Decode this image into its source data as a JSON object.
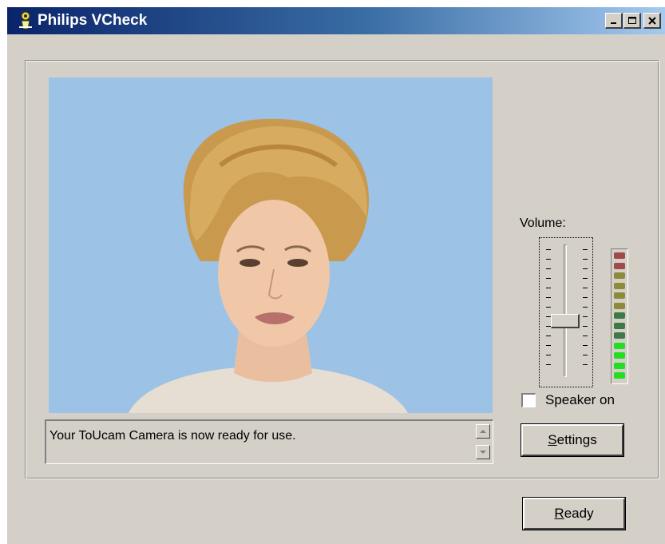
{
  "window": {
    "title": "Philips VCheck",
    "minimize_glyph": "_",
    "maximize_glyph": "□",
    "close_glyph": "✕"
  },
  "status": {
    "message": "Your ToUcam Camera is now ready for use."
  },
  "volume": {
    "label": "Volume:",
    "level_fraction": 0.45,
    "meter_levels": [
      "red",
      "red",
      "olive",
      "olive",
      "olive",
      "olive",
      "dimgreen",
      "dimgreen",
      "dimgreen",
      "green",
      "green",
      "green",
      "green"
    ],
    "meter_colors": {
      "red": "#a04a4a",
      "olive": "#8e8a3c",
      "dimgreen": "#3d7a48",
      "green": "#22dd22"
    }
  },
  "speaker": {
    "label": "Speaker on",
    "checked": false
  },
  "buttons": {
    "settings_label_first": "S",
    "settings_label_rest": "ettings",
    "ready_label_first": "R",
    "ready_label_rest": "eady"
  },
  "colors": {
    "titlebar_start": "#0a246a",
    "video_background": "#9cc2e6",
    "dialog_face": "#d4d0c8"
  },
  "icons": {
    "app": "camera-app-icon",
    "minimize": "minimize-icon",
    "maximize": "maximize-icon",
    "close": "close-icon",
    "scroll_up": "scroll-up-arrow-icon",
    "scroll_down": "scroll-down-arrow-icon"
  }
}
